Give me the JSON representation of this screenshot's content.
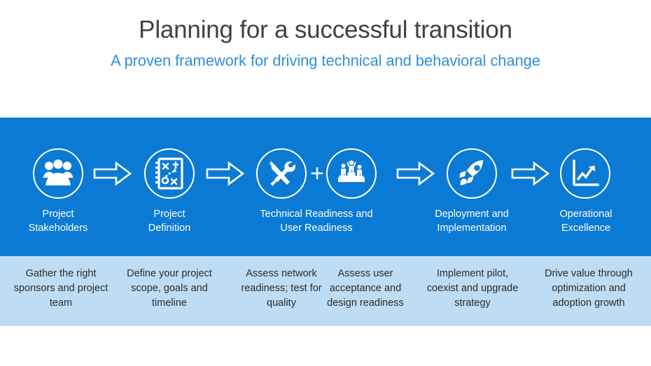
{
  "header": {
    "title": "Planning for a successful transition",
    "subtitle": "A proven framework for driving technical and behavioral change",
    "title_color": "#404040",
    "subtitle_color": "#2f8fe0"
  },
  "theme": {
    "band_blue": "#0b7ad4",
    "band_light_blue": "#bedcf4",
    "icon_white": "#ffffff",
    "body_text": "#2b2b2b"
  },
  "process": {
    "connector_plus_label": "+",
    "stages": [
      {
        "id": "project-stakeholders",
        "icon": "people-group-icon",
        "label_line1": "Project",
        "label_line2": "Stakeholders",
        "description": "Gather the right sponsors and project team"
      },
      {
        "id": "project-definition",
        "icon": "strategy-playbook-icon",
        "label_line1": "Project",
        "label_line2": "Definition",
        "description": "Define your project scope, goals and timeline"
      },
      {
        "id": "technical-readiness",
        "icon": "tools-icon",
        "label_line1": "Technical Readiness and",
        "label_line2": "User Readiness",
        "description": "Assess network readiness; test for quality"
      },
      {
        "id": "user-readiness",
        "icon": "podium-people-icon",
        "label_line1": "",
        "label_line2": "",
        "description": "Assess user acceptance and design readiness"
      },
      {
        "id": "deployment-implementation",
        "icon": "rocket-icon",
        "label_line1": "Deployment and",
        "label_line2": "Implementation",
        "description": "Implement pilot, coexist and upgrade strategy"
      },
      {
        "id": "operational-excellence",
        "icon": "growth-chart-icon",
        "label_line1": "Operational",
        "label_line2": "Excellence",
        "description": "Drive value through optimization and adoption growth"
      }
    ]
  }
}
